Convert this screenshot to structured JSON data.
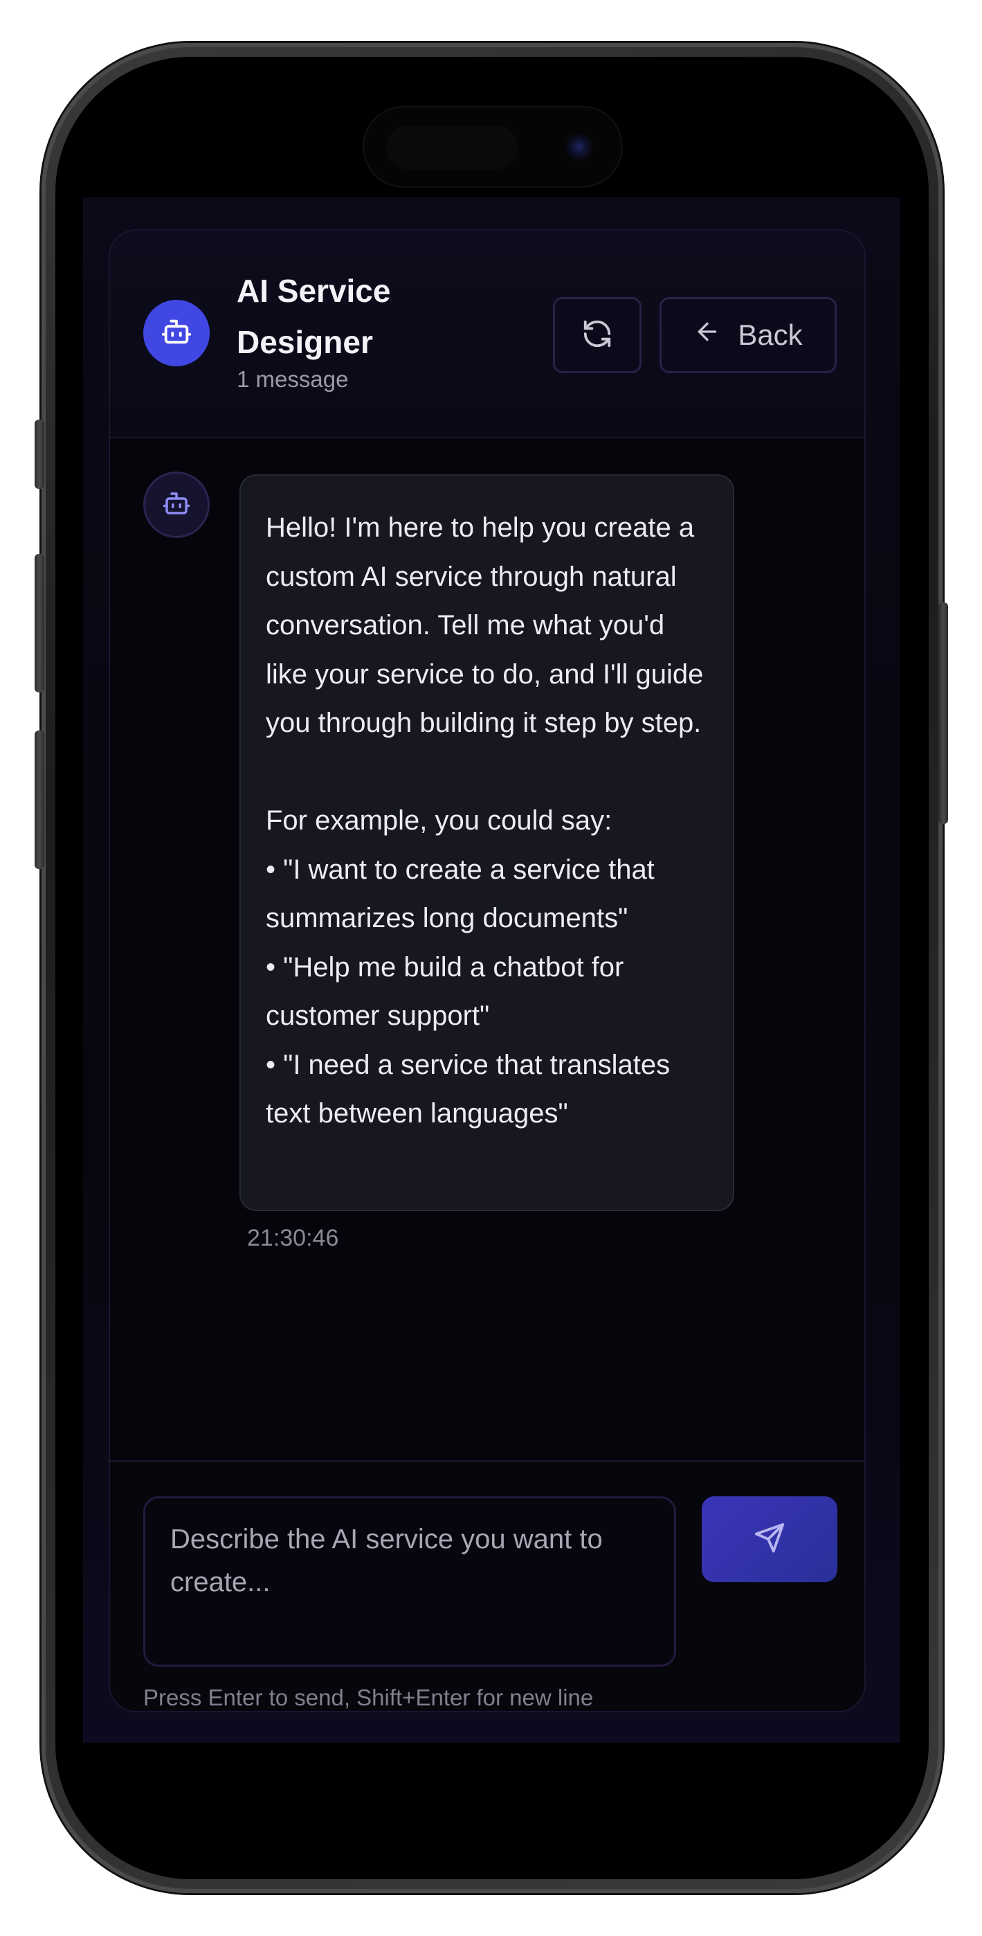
{
  "header": {
    "title": "AI Service Designer",
    "subtitle": "1 message",
    "refresh_icon": "refresh-icon",
    "back_label": "Back",
    "back_icon": "arrow-left-icon",
    "avatar_icon": "bot-icon"
  },
  "messages": [
    {
      "role": "assistant",
      "avatar_icon": "bot-icon",
      "text": "Hello! I'm here to help you create a custom AI service through natural conversation. Tell me what you'd like your service to do, and I'll guide you through building it step by step.\n\nFor example, you could say:\n• \"I want to create a service that summarizes long documents\"\n• \"Help me build a chatbot for customer support\"\n• \"I need a service that translates text between languages\"",
      "time": "21:30:46"
    }
  ],
  "composer": {
    "placeholder": "Describe the AI service you want to create...",
    "send_icon": "send-icon",
    "hint": "Press Enter to send, Shift+Enter for new line"
  },
  "colors": {
    "accent": "#4047e3",
    "send_button": "#3b35b8",
    "background": "#05050b",
    "bubble": "#16171f"
  }
}
